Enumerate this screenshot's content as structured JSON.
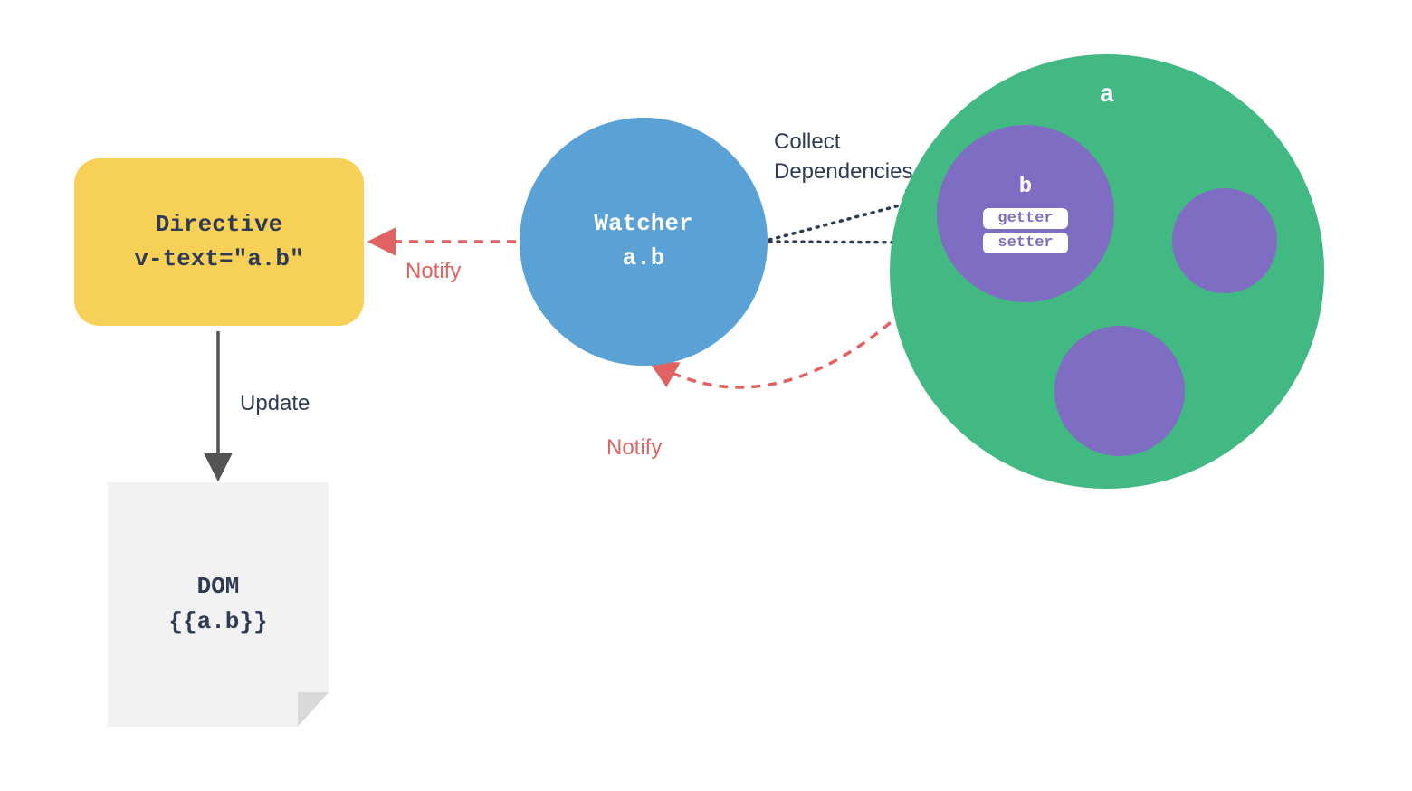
{
  "directive": {
    "title": "Directive",
    "code": "v-text=\"a.b\""
  },
  "watcher": {
    "title": "Watcher",
    "code": "a.b"
  },
  "objectA": {
    "label": "a",
    "b": {
      "label": "b",
      "getter": "getter",
      "setter": "setter"
    }
  },
  "dom": {
    "title": "DOM",
    "code": "{{a.b}}"
  },
  "labels": {
    "notify1": "Notify",
    "notify2": "Notify",
    "update": "Update",
    "collect1": "Collect",
    "collect2": "Dependencies"
  },
  "colors": {
    "yellow": "#f7d057",
    "blue": "#5aa1d6",
    "green": "#42b983",
    "purple": "#7e6dc3",
    "red": "#e16262",
    "dark": "#2f3b52",
    "gray": "#545454"
  }
}
